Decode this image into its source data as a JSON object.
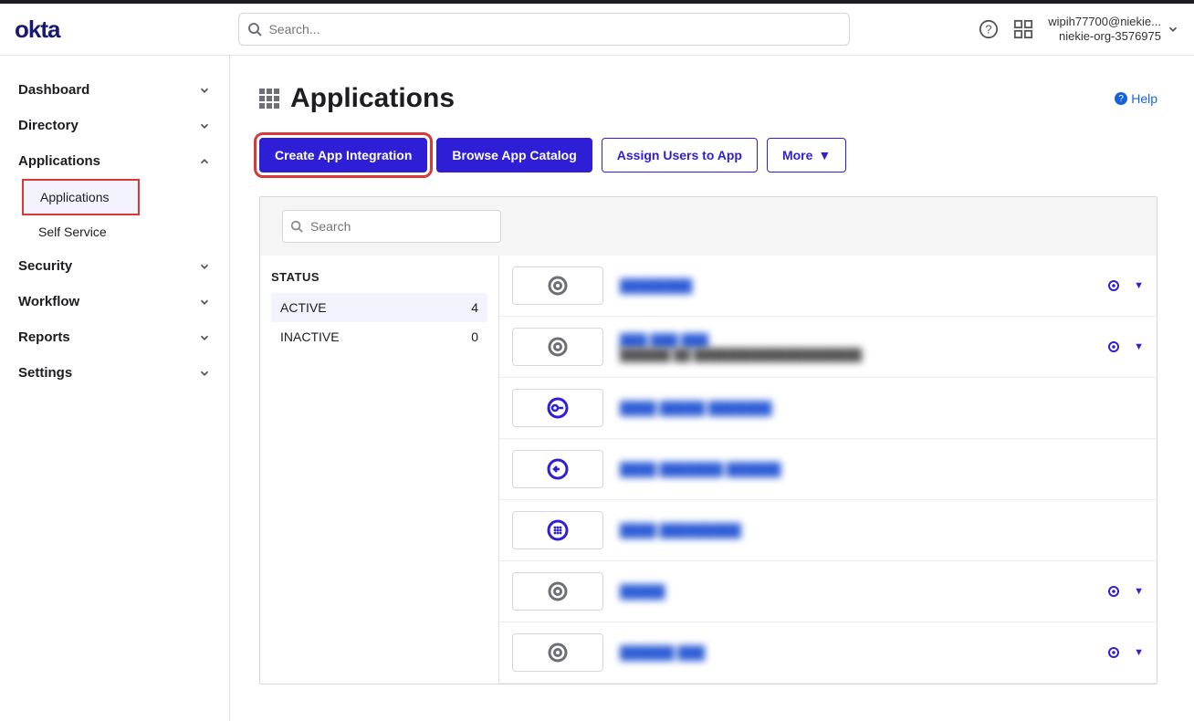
{
  "brand": "okta",
  "header": {
    "search_placeholder": "Search...",
    "user_email": "wipih77700@niekie...",
    "org_name": "niekie-org-3576975"
  },
  "sidebar": {
    "items": [
      {
        "label": "Dashboard",
        "expanded": false
      },
      {
        "label": "Directory",
        "expanded": false
      },
      {
        "label": "Applications",
        "expanded": true,
        "children": [
          {
            "label": "Applications",
            "active": true
          },
          {
            "label": "Self Service",
            "active": false
          }
        ]
      },
      {
        "label": "Security",
        "expanded": false
      },
      {
        "label": "Workflow",
        "expanded": false
      },
      {
        "label": "Reports",
        "expanded": false
      },
      {
        "label": "Settings",
        "expanded": false
      }
    ]
  },
  "page": {
    "title": "Applications",
    "help": "Help",
    "actions": {
      "create": "Create App Integration",
      "browse": "Browse App Catalog",
      "assign": "Assign Users to App",
      "more": "More"
    }
  },
  "panel": {
    "search_placeholder": "Search",
    "status_heading": "STATUS",
    "statuses": [
      {
        "label": "ACTIVE",
        "count": "4",
        "active": true
      },
      {
        "label": "INACTIVE",
        "count": "0",
        "active": false
      }
    ],
    "apps": [
      {
        "name": "████████",
        "sub": "",
        "icon": "gear",
        "has_actions": true
      },
      {
        "name": "███ ███ ███",
        "sub": "██████ ██ ████████████████████",
        "icon": "gear",
        "has_actions": true
      },
      {
        "name": "████ █████ ███████",
        "sub": "",
        "icon": "key",
        "has_actions": false
      },
      {
        "name": "████ ███████ ██████",
        "sub": "",
        "icon": "arrow",
        "has_actions": false
      },
      {
        "name": "████ █████████",
        "sub": "",
        "icon": "grid",
        "has_actions": false
      },
      {
        "name": "█████",
        "sub": "",
        "icon": "gear",
        "has_actions": true
      },
      {
        "name": "██████ ███",
        "sub": "",
        "icon": "gear",
        "has_actions": true
      }
    ]
  }
}
